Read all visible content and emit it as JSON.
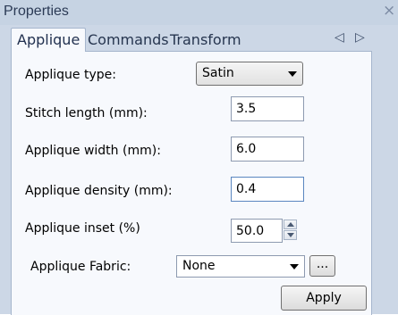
{
  "window": {
    "title": "Properties",
    "close_glyph": "×"
  },
  "tabs": [
    {
      "label": "Applique",
      "active": true
    },
    {
      "label": "Commands",
      "active": false
    },
    {
      "label": "Transform",
      "active": false
    }
  ],
  "tab_nav": {
    "left_glyph": "◁",
    "right_glyph": "▷"
  },
  "form": {
    "applique_type": {
      "label": "Applique type:",
      "value": "Satin"
    },
    "stitch_length": {
      "label": "Stitch length (mm):",
      "value": "3.5"
    },
    "applique_width": {
      "label": "Applique width (mm):",
      "value": "6.0"
    },
    "applique_density": {
      "label": "Applique density (mm):",
      "value": "0.4"
    },
    "applique_inset": {
      "label": "Applique inset (%)",
      "value": "50.0"
    },
    "applique_fabric": {
      "label": "Applique Fabric:",
      "value": "None",
      "browse_label": "..."
    }
  },
  "apply_label": "Apply",
  "colors": {
    "panel": "#ccd7e6",
    "content": "#f7f9fd",
    "border": "#a6b6cd"
  }
}
